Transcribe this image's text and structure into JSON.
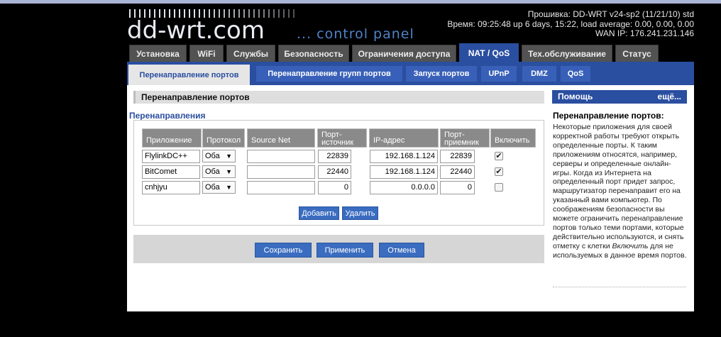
{
  "logo": {
    "main": "dd-wrt.com",
    "sub": "... control panel"
  },
  "info": {
    "firmware": "Прошивка: DD-WRT v24-sp2 (11/21/10) std",
    "time": "Время: 09:25:48 up 6 days, 15:22, load average: 0.00, 0.00, 0.00",
    "wan": "WAN IP: 176.241.231.146"
  },
  "main_tabs": [
    "Установка",
    "WiFi",
    "Службы",
    "Безопасность",
    "Ограничения доступа",
    "NAT / QoS",
    "Тех.обслуживание",
    "Статус"
  ],
  "sub_tabs": [
    "Перенаправление портов",
    "Перенаправление групп портов",
    "Запуск портов",
    "UPnP",
    "DMZ",
    "QoS"
  ],
  "section_title": "Перенаправление портов",
  "legend": "Перенаправления",
  "columns": {
    "app": "Приложение",
    "proto": "Протокол",
    "source": "Source Net",
    "from_l1": "Порт-",
    "from_l2": "источник",
    "ip": "IP-адрес",
    "to_l1": "Порт-",
    "to_l2": "приемник",
    "enable": "Включить"
  },
  "rows": [
    {
      "app": "FlylinkDC++",
      "proto": "Оба",
      "source": "",
      "from": "22839",
      "ip": "192.168.1.124",
      "to": "22839",
      "check": "✔"
    },
    {
      "app": "BitComet",
      "proto": "Оба",
      "source": "",
      "from": "22440",
      "ip": "192.168.1.124",
      "to": "22440",
      "check": "✔"
    },
    {
      "app": "cnhjyu",
      "proto": "Оба",
      "source": "",
      "from": "0",
      "ip": "0.0.0.0",
      "to": "0",
      "check": ""
    }
  ],
  "arrow": "▼",
  "buttons": {
    "add": "Добавить",
    "remove": "Удалить",
    "save": "Сохранить",
    "apply": "Применить",
    "cancel": "Отмена"
  },
  "help": {
    "head": "Помощь",
    "more": "ещё...",
    "title": "Перенаправление портов:",
    "text": "Некоторые приложения для своей корректной работы требуют открыть определенные порты. К таким приложениям относятся, например, серверы и определенные онлайн-игры. Когда из Интернета на определенный порт придет запрос, маршрутизатор перенаправит его на указанный вами компьютер. По соображениям безопасности вы можете ограничить перенаправление портов только теми портами, которые действительно используются, и снять отметку с клетки",
    "text_em": "Включить",
    "text_end": "для не используемых в данное время портов."
  },
  "colors": {
    "accent": "#2a4ea0",
    "button": "#3a6cc0",
    "tab": "#525252"
  }
}
